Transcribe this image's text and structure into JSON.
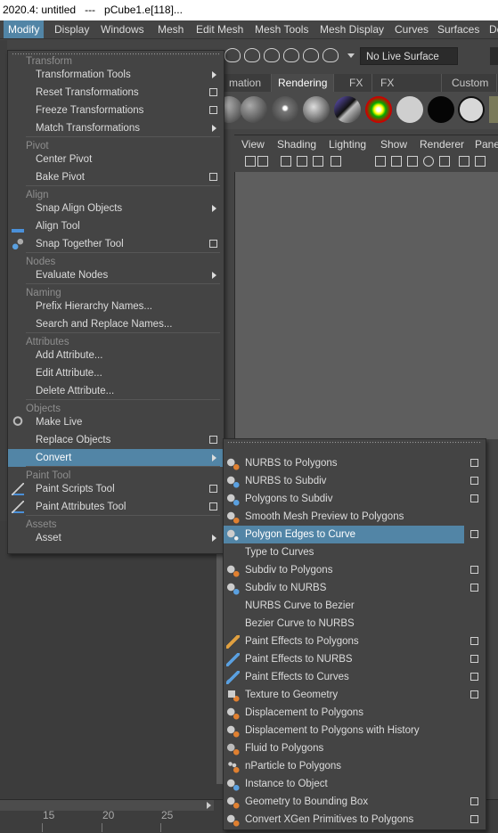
{
  "window": {
    "title": "2020.4: untitled   ---   pCube1.e[118]..."
  },
  "menubar": [
    "Modify",
    "Display",
    "Windows",
    "Mesh",
    "Edit Mesh",
    "Mesh Tools",
    "Mesh Display",
    "Curves",
    "Surfaces",
    "De"
  ],
  "toolbar": {
    "live_surface": "No Live Surface"
  },
  "shelf_tabs": [
    "mation",
    "Rendering",
    "FX",
    "FX Caching",
    "Custom"
  ],
  "panel_menu": [
    "View",
    "Shading",
    "Lighting",
    "Show",
    "Renderer",
    "Pane"
  ],
  "modify_menu": {
    "items": [
      {
        "type": "section",
        "label": "Transform"
      },
      {
        "type": "item",
        "label": "Transformation Tools",
        "submenu": true
      },
      {
        "type": "item",
        "label": "Reset Transformations",
        "option": true
      },
      {
        "type": "item",
        "label": "Freeze Transformations",
        "option": true
      },
      {
        "type": "item",
        "label": "Match Transformations",
        "submenu": true
      },
      {
        "type": "section",
        "label": "Pivot"
      },
      {
        "type": "item",
        "label": "Center Pivot"
      },
      {
        "type": "item",
        "label": "Bake Pivot",
        "option": true
      },
      {
        "type": "section",
        "label": "Align"
      },
      {
        "type": "item",
        "label": "Snap Align Objects",
        "submenu": true
      },
      {
        "type": "item",
        "label": "Align Tool",
        "icon": "align-tool-icon"
      },
      {
        "type": "item",
        "label": "Snap Together Tool",
        "option": true,
        "icon": "snap-together-icon"
      },
      {
        "type": "section",
        "label": "Nodes"
      },
      {
        "type": "item",
        "label": "Evaluate Nodes",
        "submenu": true
      },
      {
        "type": "section",
        "label": "Naming"
      },
      {
        "type": "item",
        "label": "Prefix Hierarchy Names..."
      },
      {
        "type": "item",
        "label": "Search and Replace Names..."
      },
      {
        "type": "section",
        "label": "Attributes"
      },
      {
        "type": "item",
        "label": "Add Attribute..."
      },
      {
        "type": "item",
        "label": "Edit Attribute..."
      },
      {
        "type": "item",
        "label": "Delete Attribute..."
      },
      {
        "type": "section",
        "label": "Objects"
      },
      {
        "type": "item",
        "label": "Make Live",
        "icon": "magnet-icon"
      },
      {
        "type": "item",
        "label": "Replace Objects",
        "option": true
      },
      {
        "type": "item",
        "label": "Convert",
        "submenu": true,
        "highlight": true
      },
      {
        "type": "section",
        "label": "Paint Tool"
      },
      {
        "type": "item",
        "label": "Paint Scripts Tool",
        "option": true,
        "icon": "paint-brush-icon"
      },
      {
        "type": "item",
        "label": "Paint Attributes Tool",
        "option": true,
        "icon": "paint-attributes-icon"
      },
      {
        "type": "section",
        "label": "Assets"
      },
      {
        "type": "item",
        "label": "Asset",
        "submenu": true
      }
    ]
  },
  "convert_menu": {
    "items": [
      {
        "label": "NURBS to Polygons",
        "option": true,
        "icon": "nurbs-to-polygons-icon"
      },
      {
        "label": "NURBS to Subdiv",
        "option": true,
        "icon": "nurbs-to-subdiv-icon"
      },
      {
        "label": "Polygons to Subdiv",
        "option": true,
        "icon": "polygons-to-subdiv-icon"
      },
      {
        "label": "Smooth Mesh Preview to Polygons",
        "option": false,
        "icon": "smooth-mesh-icon"
      },
      {
        "label": "Polygon Edges to Curve",
        "option": true,
        "icon": "edges-to-curve-icon",
        "highlight": true
      },
      {
        "label": "Type to Curves",
        "option": false,
        "icon": ""
      },
      {
        "label": "Subdiv to Polygons",
        "option": true,
        "icon": "subdiv-to-polygons-icon"
      },
      {
        "label": "Subdiv to NURBS",
        "option": true,
        "icon": "subdiv-to-nurbs-icon"
      },
      {
        "label": "NURBS Curve to Bezier",
        "option": false,
        "icon": ""
      },
      {
        "label": "Bezier Curve to NURBS",
        "option": false,
        "icon": ""
      },
      {
        "label": "Paint Effects to Polygons",
        "option": true,
        "icon": "paint-effects-polygons-icon"
      },
      {
        "label": "Paint Effects to NURBS",
        "option": true,
        "icon": "paint-effects-nurbs-icon"
      },
      {
        "label": "Paint Effects to Curves",
        "option": true,
        "icon": "paint-effects-curves-icon"
      },
      {
        "label": "Texture to Geometry",
        "option": true,
        "icon": "texture-to-geometry-icon"
      },
      {
        "label": "Displacement to Polygons",
        "option": false,
        "icon": "displacement-icon"
      },
      {
        "label": "Displacement to Polygons with History",
        "option": false,
        "icon": "displacement-history-icon"
      },
      {
        "label": "Fluid to Polygons",
        "option": false,
        "icon": "fluid-icon"
      },
      {
        "label": "nParticle to Polygons",
        "option": false,
        "icon": "nparticle-icon"
      },
      {
        "label": "Instance to Object",
        "option": false,
        "icon": "instance-icon"
      },
      {
        "label": "Geometry to Bounding Box",
        "option": true,
        "icon": "bounding-box-icon"
      },
      {
        "label": "Convert XGen Primitives to Polygons",
        "option": true,
        "icon": "xgen-icon"
      }
    ]
  },
  "timeline": {
    "ticks": [
      "15",
      "20",
      "25"
    ]
  },
  "colors": {
    "highlight": "#5285a6",
    "menu_bg": "#444444",
    "section": "#8e8e8e"
  }
}
